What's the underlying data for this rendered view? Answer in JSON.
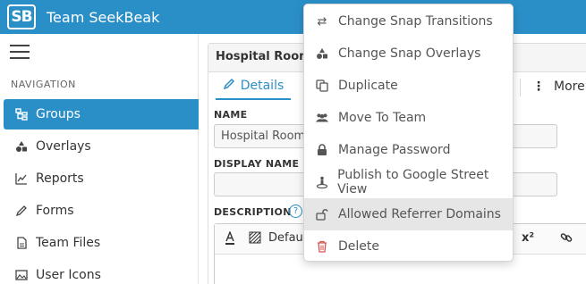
{
  "app": {
    "logo": "SB",
    "name": "Team SeekBeak"
  },
  "sidebar": {
    "heading": "NAVIGATION",
    "items": [
      {
        "label": "Groups",
        "icon": "groups-icon",
        "active": true
      },
      {
        "label": "Overlays",
        "icon": "overlays-icon"
      },
      {
        "label": "Reports",
        "icon": "reports-icon"
      },
      {
        "label": "Forms",
        "icon": "forms-icon"
      },
      {
        "label": "Team Files",
        "icon": "file-icon"
      },
      {
        "label": "User Icons",
        "icon": "image-icon"
      }
    ]
  },
  "panel": {
    "title": "Hospital Room",
    "tabs": {
      "details": "Details",
      "more": "More"
    },
    "fields": {
      "name_label": "NAME",
      "name_value": "Hospital Room",
      "display_name_label": "DISPLAY NAME",
      "display_name_value": "",
      "description_label": "DESCRIPTION"
    },
    "editor": {
      "font_value": "Defau",
      "superscript": "x²"
    }
  },
  "menu": {
    "items": [
      {
        "label": "Change Snap Transitions",
        "icon": "swap-arrows-icon"
      },
      {
        "label": "Change Snap Overlays",
        "icon": "shapes-icon"
      },
      {
        "label": "Duplicate",
        "icon": "copy-icon"
      },
      {
        "label": "Move To Team",
        "icon": "users-icon"
      },
      {
        "label": "Manage Password",
        "icon": "lock-icon"
      },
      {
        "label": "Publish to Google Street View",
        "icon": "street-view-icon"
      },
      {
        "label": "Allowed Referrer Domains",
        "icon": "unlock-icon",
        "hover": true
      },
      {
        "label": "Delete",
        "icon": "trash-icon",
        "danger": true
      }
    ]
  },
  "colors": {
    "primary": "#2a8fc7",
    "danger": "#d9534f",
    "hover": "#e6e6e6"
  }
}
